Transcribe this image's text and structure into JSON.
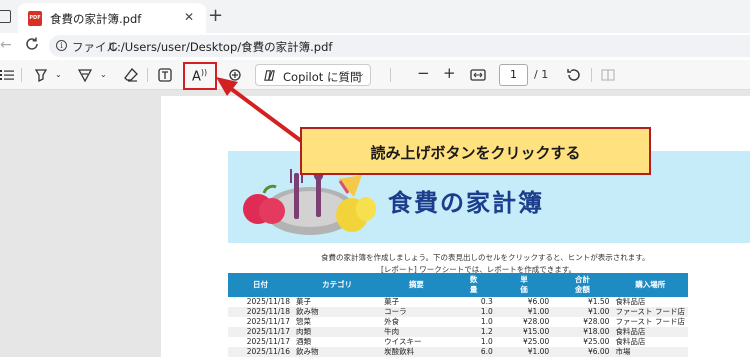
{
  "tab": {
    "title": "食費の家計簿.pdf",
    "pdf_badge": "PDF",
    "close": "✕",
    "new_tab": "+"
  },
  "address": {
    "label": "ファイル",
    "url": "C:/Users/user/Desktop/食費の家計簿.pdf"
  },
  "toolbar": {
    "copilot_label": "Copilot に質問",
    "page_number": "1",
    "page_total": "/ 1"
  },
  "callout": {
    "text": "読み上げボタンをクリックする"
  },
  "document": {
    "title": "食費の家計簿",
    "intro_line1": "食費の家計簿を作成しましょう。下の表見出しのセルをクリックすると、ヒントが表示されます。",
    "intro_line2": "[レポート] ワークシートでは、レポートを作成できます。",
    "headers": [
      "日付",
      "カテゴリ",
      "摘要",
      "数量",
      "単価",
      "合計金額",
      "購入場所"
    ],
    "rows": [
      [
        "2025/11/18",
        "菓子",
        "菓子",
        "0.3",
        "¥6.00",
        "¥1.50",
        "食料品店"
      ],
      [
        "2025/11/18",
        "飲み物",
        "コーラ",
        "1.0",
        "¥1.00",
        "¥1.00",
        "ファースト フード店"
      ],
      [
        "2025/11/17",
        "惣菜",
        "外食",
        "1.0",
        "¥28.00",
        "¥28.00",
        "ファースト フード店"
      ],
      [
        "2025/11/17",
        "肉類",
        "牛肉",
        "1.2",
        "¥15.00",
        "¥18.00",
        "食料品店"
      ],
      [
        "2025/11/17",
        "酒類",
        "ウイスキー",
        "1.0",
        "¥25.00",
        "¥25.00",
        "食料品店"
      ],
      [
        "2025/11/16",
        "飲み物",
        "炭酸飲料",
        "6.0",
        "¥1.00",
        "¥6.00",
        "市場"
      ]
    ]
  },
  "colors": {
    "accent_red": "#d32020",
    "callout_bg": "#ffe17f",
    "table_header": "#1f8bc3",
    "title_blue": "#1c3d8c",
    "banner": "#c5ecf8"
  }
}
